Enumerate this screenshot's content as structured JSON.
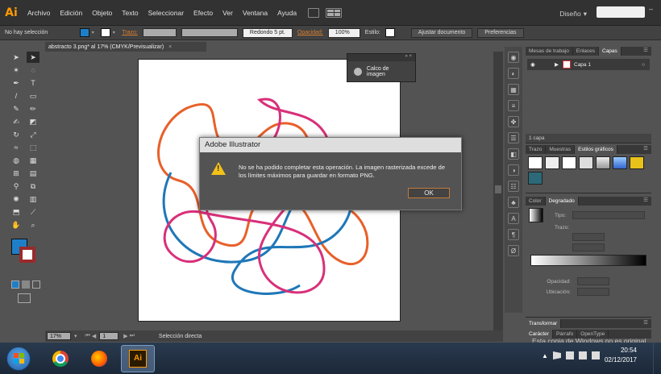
{
  "app": {
    "logo": "Ai",
    "workspace": "Diseño"
  },
  "menu": [
    "Archivo",
    "Edición",
    "Objeto",
    "Texto",
    "Seleccionar",
    "Efecto",
    "Ver",
    "Ventana",
    "Ayuda"
  ],
  "control": {
    "selection": "No hay selección",
    "stroke_label": "Trazo:",
    "brush": "Redondo 5 pt.",
    "opacity_label": "Opacidad:",
    "opacity": "100%",
    "style_label": "Estilo:",
    "adjust_btn": "Ajustar documento",
    "prefs_btn": "Preferencias"
  },
  "document": {
    "tab": "abstracto 3.png* al 17% (CMYK/Previsualizar)"
  },
  "status": {
    "zoom": "17%",
    "page": "1",
    "tool": "Selección directa"
  },
  "calco": {
    "label": "Calco de imagen"
  },
  "panels": {
    "layers_tabs": [
      "Mesas de trabajo",
      "Enlaces",
      "Capas"
    ],
    "layer_name": "Capa 1",
    "layers_count": "1 capa",
    "styles_tabs": [
      "Trazo",
      "Muestras",
      "Estilos gráficos"
    ],
    "gradient_tabs": [
      "Color",
      "Degradado"
    ],
    "gradient_type": "Tipo:",
    "gradient_stroke": "Trazo:",
    "gradient_opacity": "Opacidad:",
    "gradient_location": "Ubicación:",
    "transform_tab": "Transformar",
    "char_tabs": [
      "Carácter",
      "Párrafo",
      "OpenType"
    ]
  },
  "dialog": {
    "title": "Adobe Illustrator",
    "message": "No se ha podido completar esta operación. La imagen rasterizada excede de los límites máximos para guardar en formato PNG.",
    "ok": "OK"
  },
  "taskbar": {
    "watermark": "Esta copia de Windows no es original",
    "time": "20:54",
    "date": "02/12/2017"
  },
  "colors": {
    "fill": "#1e7fc8",
    "accent": "#ff9a00",
    "art_blue": "#1f77b8",
    "art_orange": "#e8602a",
    "art_pink": "#d8307a"
  }
}
